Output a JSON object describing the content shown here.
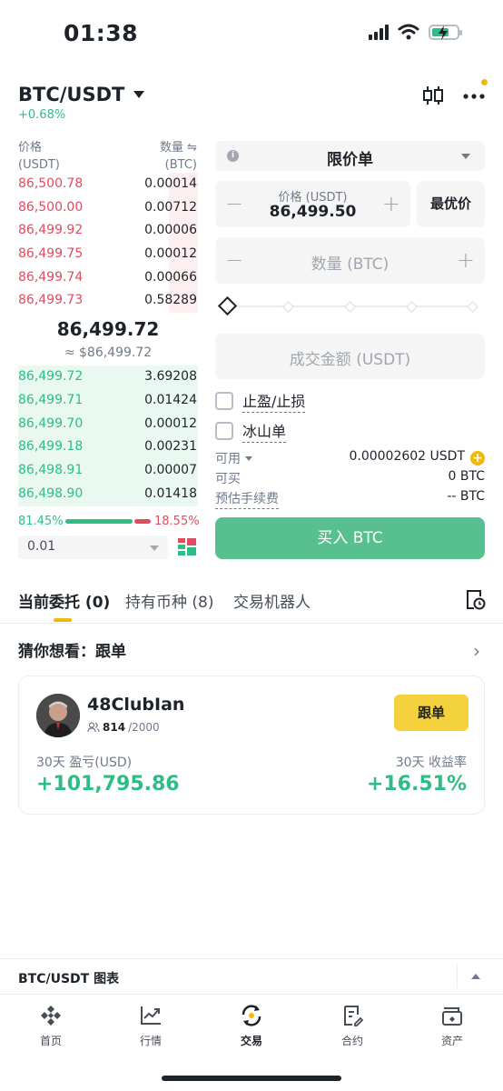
{
  "status": {
    "time": "01:38"
  },
  "header": {
    "pair": "BTC/USDT",
    "change": "+0.68%"
  },
  "order_book": {
    "price_header": "价格",
    "price_unit": "(USDT)",
    "qty_header": "数量 ⇋",
    "qty_unit": "(BTC)",
    "asks": [
      {
        "price": "86,500.78",
        "qty": "0.00014",
        "depth": 0.16
      },
      {
        "price": "86,500.00",
        "qty": "0.00712",
        "depth": 0.16
      },
      {
        "price": "86,499.92",
        "qty": "0.00006",
        "depth": 0.16
      },
      {
        "price": "86,499.75",
        "qty": "0.00012",
        "depth": 0.16
      },
      {
        "price": "86,499.74",
        "qty": "0.00066",
        "depth": 0.16
      },
      {
        "price": "86,499.73",
        "qty": "0.58289",
        "depth": 0.16
      }
    ],
    "mid_price": "86,499.72",
    "mid_fiat": "≈ $86,499.72",
    "bids": [
      {
        "price": "86,499.72",
        "qty": "3.69208"
      },
      {
        "price": "86,499.71",
        "qty": "0.01424"
      },
      {
        "price": "86,499.70",
        "qty": "0.00012"
      },
      {
        "price": "86,499.18",
        "qty": "0.00231"
      },
      {
        "price": "86,498.91",
        "qty": "0.00007"
      },
      {
        "price": "86,498.90",
        "qty": "0.01418"
      }
    ],
    "buy_ratio": "81.45%",
    "sell_ratio": "18.55%",
    "precision": "0.01"
  },
  "order_form": {
    "order_type": "限价单",
    "price_label": "价格 (USDT)",
    "price_value": "86,499.50",
    "best_price": "最优价",
    "qty_placeholder": "数量 (BTC)",
    "total_placeholder": "成交金额 (USDT)",
    "tp_sl": "止盈/止损",
    "iceberg": "冰山单",
    "available_label": "可用",
    "available_value": "0.00002602 USDT",
    "can_buy_label": "可买",
    "can_buy_value": "0 BTC",
    "fee_label": "预估手续费",
    "fee_value": "-- BTC",
    "buy_button": "买入 BTC",
    "colors": {
      "buy": "#58c08e",
      "sell": "#e04c60",
      "accent": "#f0b90b"
    }
  },
  "tabs": {
    "open_orders": "当前委托 (0)",
    "holdings": "持有币种 (8)",
    "bots": "交易机器人"
  },
  "guess": {
    "title": "猜你想看：跟单",
    "trader": {
      "name": "48ClubIan",
      "followers": "814",
      "followers_max": "/2000",
      "follow_button": "跟单",
      "pnl_label": "30天 盈亏(USD)",
      "pnl_value": "+101,795.86",
      "roi_label": "30天 收益率",
      "roi_value": "+16.51%"
    }
  },
  "chart_bar": {
    "label": "BTC/USDT 图表"
  },
  "nav": {
    "home": "首页",
    "markets": "行情",
    "trade": "交易",
    "futures": "合约",
    "assets": "资产"
  }
}
